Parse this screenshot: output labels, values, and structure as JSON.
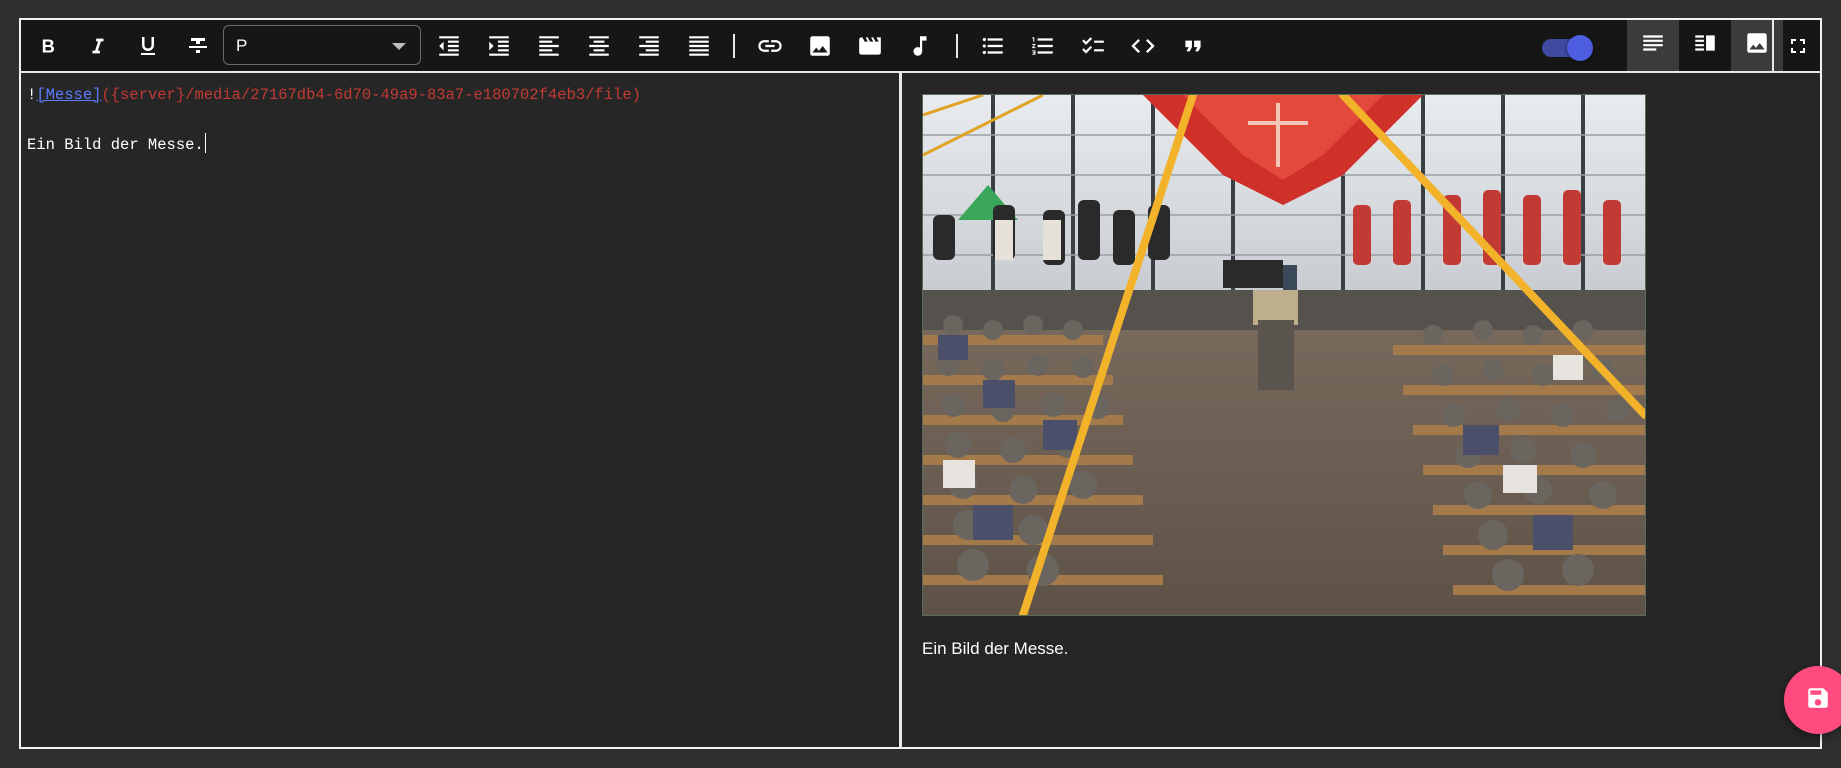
{
  "toolbar": {
    "bold_label": "B",
    "format_select": {
      "value": "P"
    },
    "preview_toggle": {
      "on": true
    },
    "view_modes": [
      "editor",
      "split",
      "preview"
    ],
    "active_view_modes": [
      "editor",
      "preview"
    ]
  },
  "editor": {
    "lines": [
      {
        "bang": "!",
        "link_text": "[Messe]",
        "url": "({server}/media/27167db4-6d70-49a9-83a7-e180702f4eb3/file)"
      },
      {
        "text": ""
      },
      {
        "text": "Ein Bild der Messe."
      }
    ]
  },
  "preview": {
    "image_alt": "Messe",
    "caption": "Ein Bild der Messe."
  },
  "colors": {
    "background": "#2f2f2f",
    "toolbar": "#161616",
    "pane": "#262626",
    "link": "#5c7cff",
    "url": "#c23a34",
    "toggle": "#4d5fe0",
    "fab": "#ff4b80"
  },
  "icons": [
    "bold-icon",
    "italic-icon",
    "underline-icon",
    "strikethrough-icon",
    "outdent-icon",
    "indent-icon",
    "align-left-icon",
    "align-center-icon",
    "align-right-icon",
    "align-justify-icon",
    "link-icon",
    "image-icon",
    "video-icon",
    "music-icon",
    "bullet-list-icon",
    "numbered-list-icon",
    "checklist-icon",
    "code-icon",
    "quote-icon",
    "fullscreen-icon",
    "save-icon"
  ]
}
